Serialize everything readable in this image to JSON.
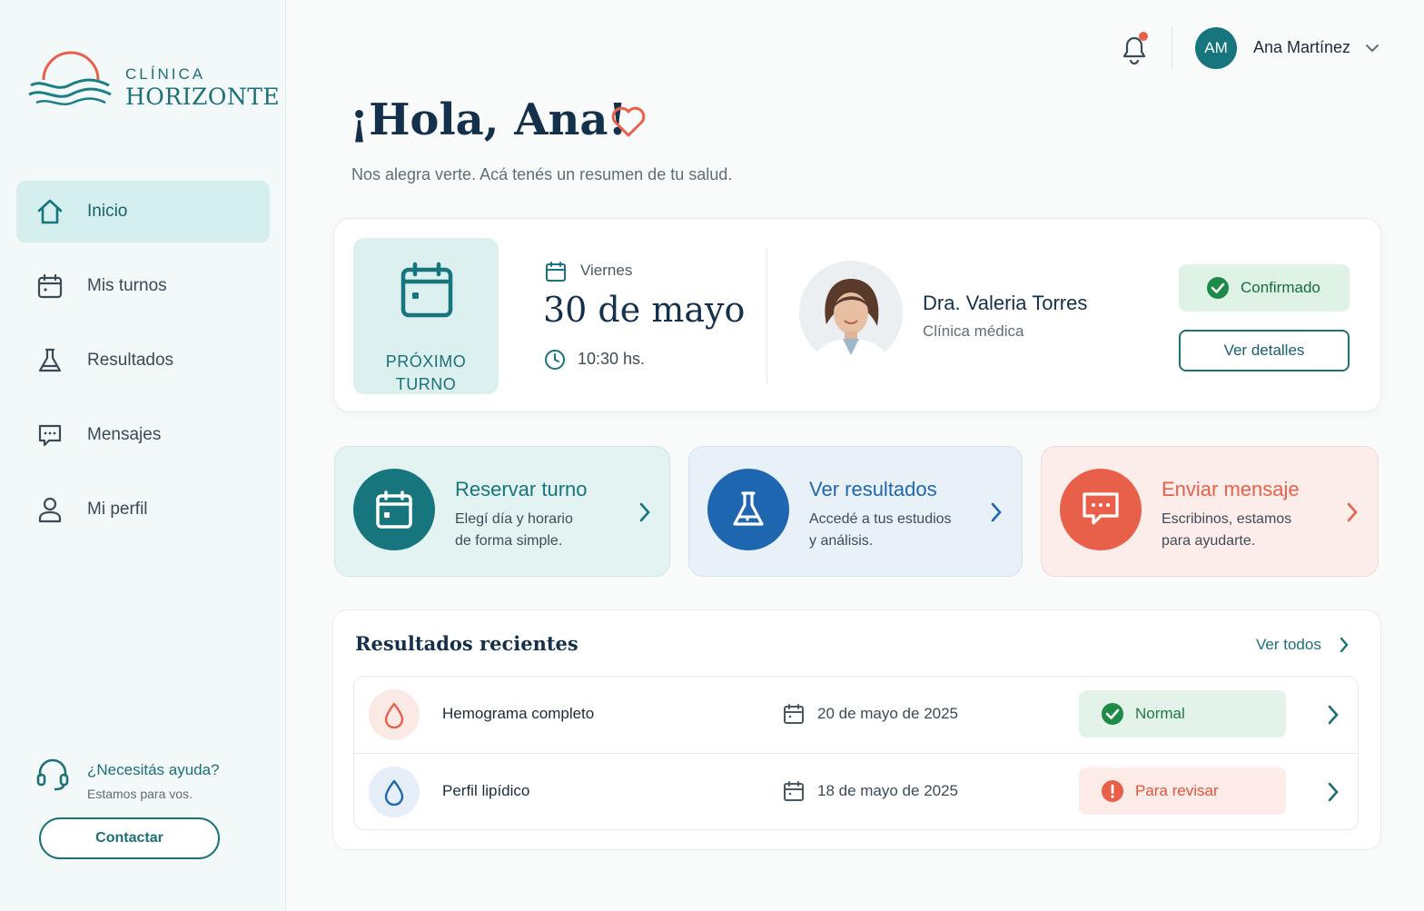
{
  "brand": {
    "line1": "CLÍNICA",
    "line2": "HORIZONTE"
  },
  "sidebar": {
    "items": [
      {
        "label": "Inicio",
        "icon": "home-icon",
        "active": true
      },
      {
        "label": "Mis turnos",
        "icon": "calendar-icon",
        "active": false
      },
      {
        "label": "Resultados",
        "icon": "flask-icon",
        "active": false
      },
      {
        "label": "Mensajes",
        "icon": "chat-icon",
        "active": false
      },
      {
        "label": "Mi perfil",
        "icon": "user-icon",
        "active": false
      }
    ],
    "help": {
      "title": "¿Necesitás ayuda?",
      "subtitle": "Estamos para vos.",
      "button": "Contactar"
    }
  },
  "header": {
    "user_initials": "AM",
    "user_name": "Ana Martínez",
    "notification_dot": true
  },
  "greeting": {
    "title": "¡Hola, Ana!",
    "subtitle": "Nos alegra verte. Acá tenés un resumen de tu salud."
  },
  "appointment": {
    "tile_label_1": "PRÓXIMO",
    "tile_label_2": "TURNO",
    "weekday": "Viernes",
    "date": "30 de mayo",
    "time": "10:30 hs.",
    "doctor_name": "Dra. Valeria Torres",
    "specialty": "Clínica médica",
    "status": "Confirmado",
    "details_button": "Ver detalles"
  },
  "actions": [
    {
      "title": "Reservar turno",
      "desc1": "Elegí día y horario",
      "desc2": "de forma simple.",
      "color": "#16757d",
      "icon": "calendar-icon"
    },
    {
      "title": "Ver resultados",
      "desc1": "Accedé a tus estudios",
      "desc2": "y análisis.",
      "color": "#1e67b0",
      "icon": "flask-icon"
    },
    {
      "title": "Enviar mensaje",
      "desc1": "Escribinos, estamos",
      "desc2": "para ayudarte.",
      "color": "#e8604a",
      "icon": "chat-icon"
    }
  ],
  "results": {
    "title": "Resultados recientes",
    "see_all": "Ver todos",
    "rows": [
      {
        "name": "Hemograma completo",
        "date": "20 de mayo de 2025",
        "status": "Normal",
        "status_color": "#1e8a47"
      },
      {
        "name": "Perfil lipídico",
        "date": "18 de mayo de 2025",
        "status": "Para revisar",
        "status_color": "#e8604a"
      }
    ]
  },
  "colors": {
    "teal": "#16757d",
    "blue": "#1e67b0",
    "coral": "#e8604a",
    "green": "#1e8a47"
  }
}
